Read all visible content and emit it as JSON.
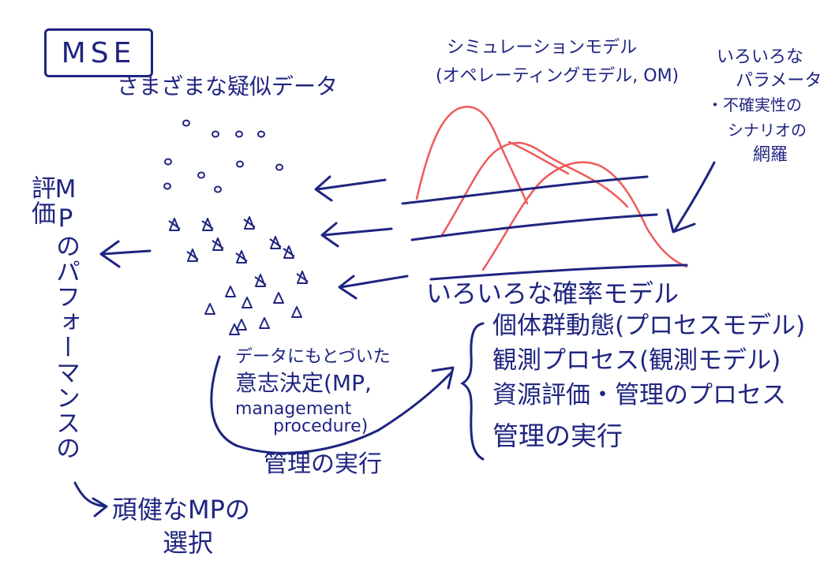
{
  "title": "MSE",
  "data_cloud_label": "さまざまな疑似データ",
  "simulation_model": {
    "line1": "シミュレーションモデル",
    "line2": "(オペレーティングモデル, OM)"
  },
  "parameters": {
    "line1": "いろいろな",
    "line2": "パラメータ",
    "line3": "・不確実性の",
    "line4": "シナリオの",
    "line5": "網羅"
  },
  "mp_evaluation": "MPのパフォーマンスの評価",
  "robust_mp": {
    "line1": "頑健なMPの",
    "line2": "選択"
  },
  "probability_models": "いろいろな確率モデル",
  "process_list": [
    "個体群動態(プロセスモデル)",
    "観測プロセス(観測モデル)",
    "資源評価・管理のプロセス",
    "管理の実行"
  ],
  "decision": {
    "line1": "データにもとづいた",
    "line2": "意志決定(MP,",
    "line3": "management",
    "line4": "procedure)"
  },
  "management_execution": "管理の実行",
  "colors": {
    "ink": "#1f2580",
    "curve": "#ef5a5a"
  },
  "icons": {
    "circle_points": "circle-marker",
    "cross_points": "cross-marker",
    "triangle_points": "triangle-marker"
  }
}
